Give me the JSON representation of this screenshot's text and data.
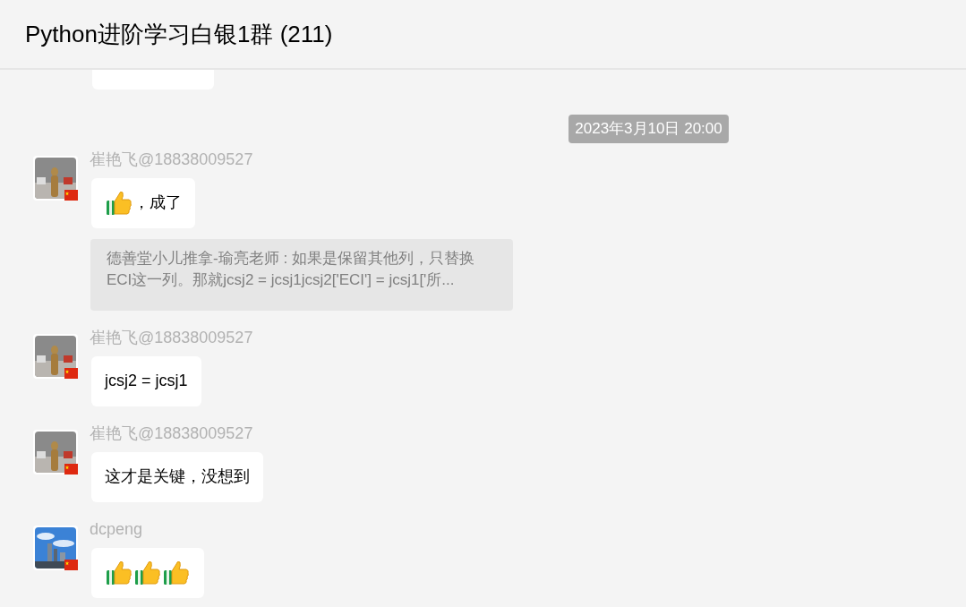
{
  "window": {
    "title": "Python进阶学习白银1群 (211)"
  },
  "timestamp": "2023年3月10日 20:00",
  "messages": [
    {
      "sender": "崔艳飞@18838009527",
      "parts": [
        {
          "kind": "thumbs-up"
        },
        {
          "kind": "text",
          "text": "，成了"
        }
      ],
      "quote": "德善堂小儿推拿-瑜亮老师 : 如果是保留其他列，只替换ECI这一列。那就jcsj2 = jcsj1jcsj2['ECI'] = jcsj1['所..."
    },
    {
      "sender": "崔艳飞@18838009527",
      "parts": [
        {
          "kind": "text",
          "text": "jcsj2 = jcsj1"
        }
      ]
    },
    {
      "sender": "崔艳飞@18838009527",
      "parts": [
        {
          "kind": "text",
          "text": "这才是关键，没想到"
        }
      ]
    },
    {
      "sender": "dcpeng",
      "parts": [
        {
          "kind": "thumbs-up"
        },
        {
          "kind": "thumbs-up"
        },
        {
          "kind": "thumbs-up"
        }
      ]
    }
  ]
}
